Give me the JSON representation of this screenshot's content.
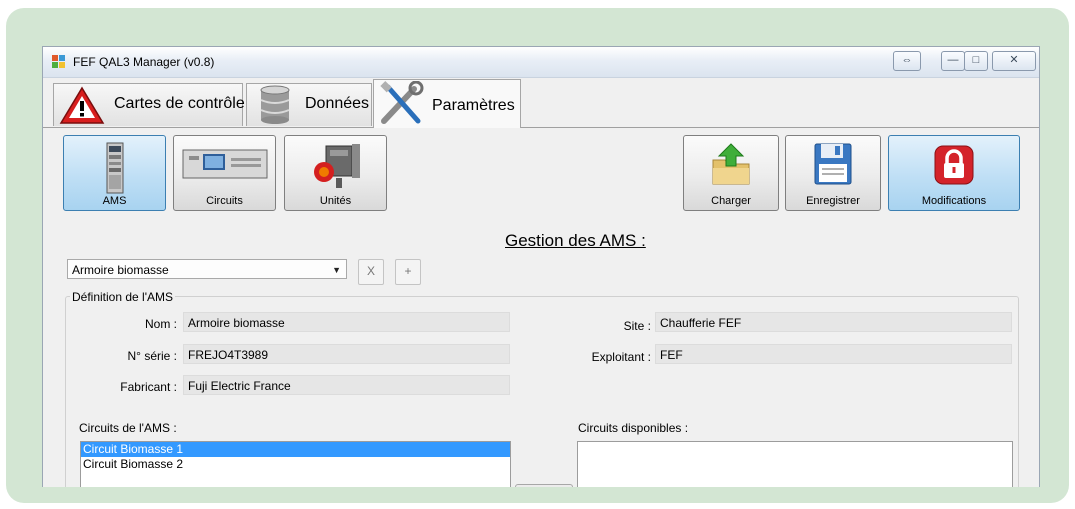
{
  "window": {
    "title": "FEF QAL3 Manager (v0.8)",
    "controls": {
      "extra": "⇔",
      "minimize": "—",
      "maximize": "□",
      "close": "✕"
    }
  },
  "tabs": [
    {
      "label": "Cartes de contrôle",
      "icon": "warning-icon"
    },
    {
      "label": "Données",
      "icon": "database-icon"
    },
    {
      "label": "Paramètres",
      "icon": "tools-icon"
    }
  ],
  "toolbar": {
    "ams": "AMS",
    "circuits": "Circuits",
    "unites": "Unités",
    "charger": "Charger",
    "enregistrer": "Enregistrer",
    "modifications": "Modifications"
  },
  "section_title": "Gestion des AMS :",
  "selector": {
    "value": "Armoire biomasse",
    "delete": "X",
    "add": "+"
  },
  "definition": {
    "legend": "Définition de l'AMS",
    "nom_label": "Nom :",
    "nom_value": "Armoire biomasse",
    "serie_label": "N° série :",
    "serie_value": "FREJO4T3989",
    "fabricant_label": "Fabricant :",
    "fabricant_value": "Fuji Electric France",
    "site_label": "Site :",
    "site_value": "Chaufferie FEF",
    "exploitant_label": "Exploitant :",
    "exploitant_value": "FEF"
  },
  "circuits_ams": {
    "label": "Circuits de l'AMS :",
    "items": [
      "Circuit Biomasse 1",
      "Circuit Biomasse 2"
    ]
  },
  "circuits_disponibles": {
    "label": "Circuits disponibles :"
  },
  "colors": {
    "frame": "#d3e6d3",
    "selection": "#3399ff",
    "selected_button": "#bfdff5",
    "lock_red": "#d4232a"
  }
}
